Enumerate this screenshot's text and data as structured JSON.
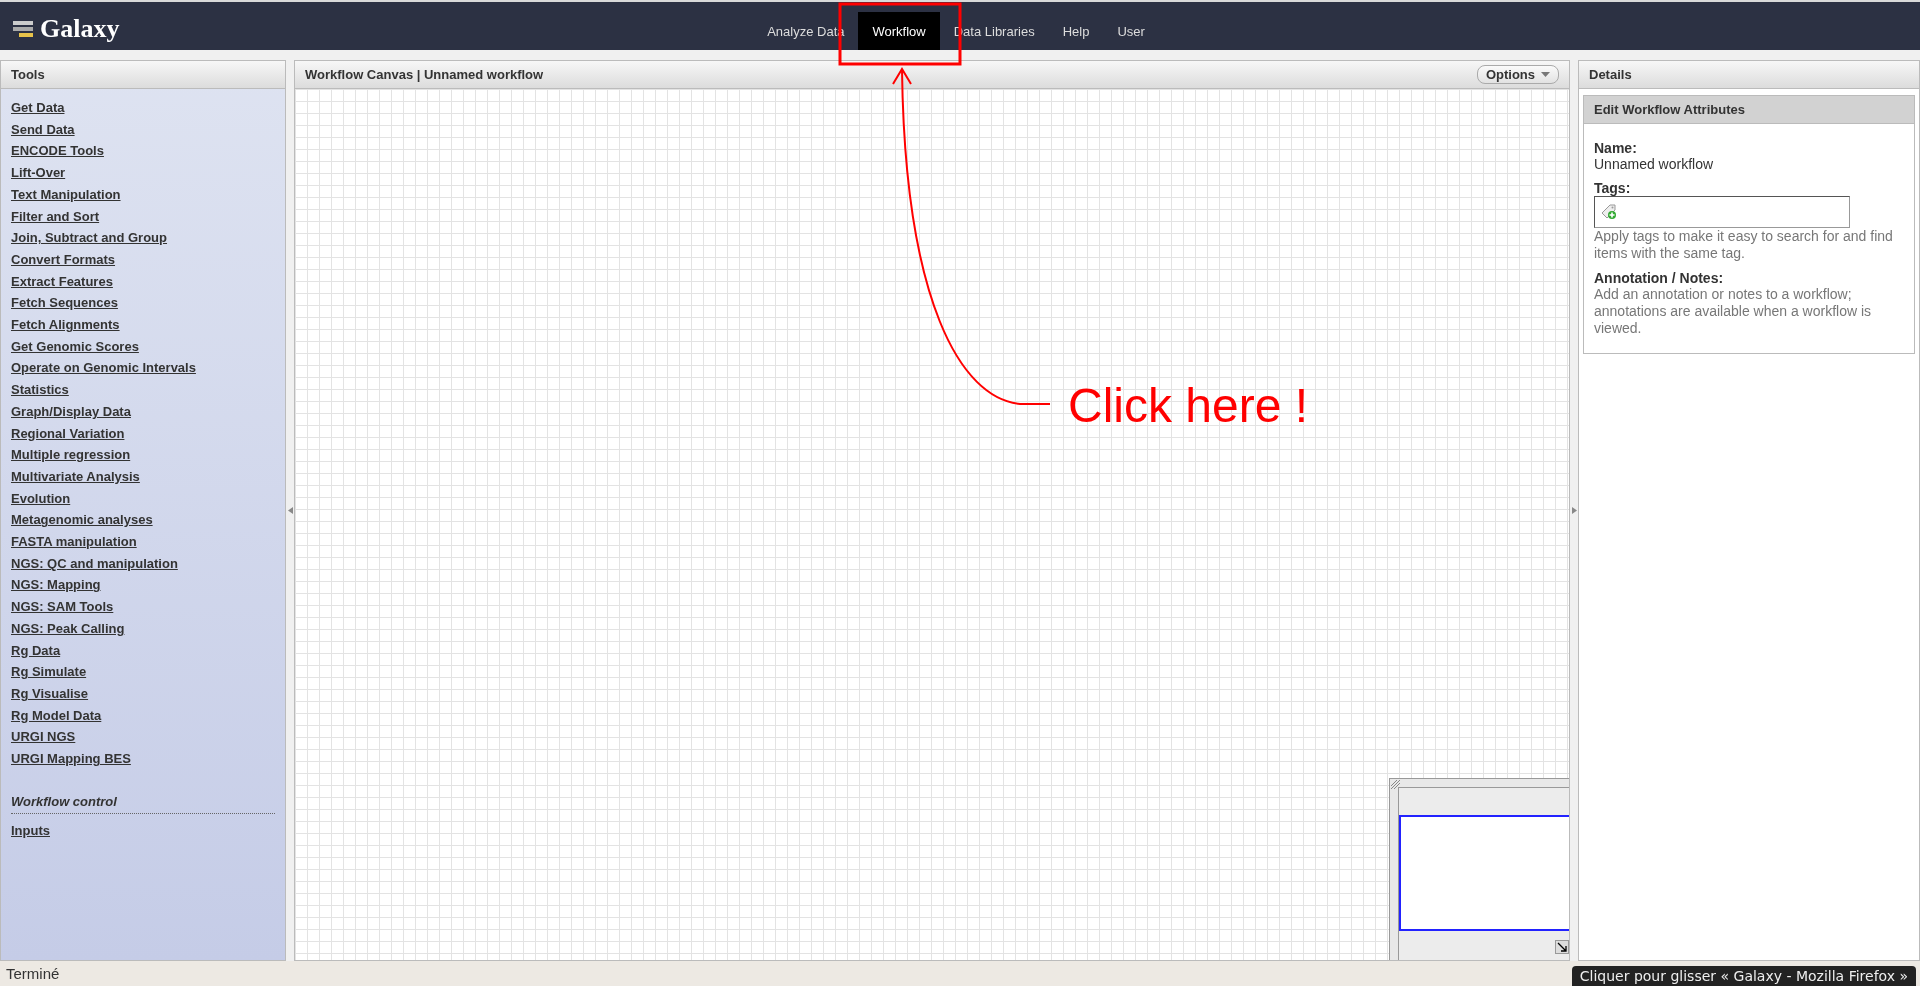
{
  "masthead": {
    "brand": "Galaxy",
    "nav": [
      {
        "label": "Analyze Data",
        "selected": false
      },
      {
        "label": "Workflow",
        "selected": true
      },
      {
        "label": "Data Libraries",
        "selected": false
      },
      {
        "label": "Help",
        "selected": false
      },
      {
        "label": "User",
        "selected": false
      }
    ]
  },
  "tool_panel": {
    "title": "Tools",
    "sections": [
      "Get Data",
      "Send Data",
      "ENCODE Tools",
      "Lift-Over",
      "Text Manipulation",
      "Filter and Sort",
      "Join, Subtract and Group",
      "Convert Formats",
      "Extract Features",
      "Fetch Sequences",
      "Fetch Alignments",
      "Get Genomic Scores",
      "Operate on Genomic Intervals",
      "Statistics",
      "Graph/Display Data",
      "Regional Variation",
      "Multiple regression",
      "Multivariate Analysis",
      "Evolution",
      "Metagenomic analyses",
      "FASTA manipulation",
      "NGS: QC and manipulation",
      "NGS: Mapping",
      "NGS: SAM Tools",
      "NGS: Peak Calling",
      "Rg Data",
      "Rg Simulate",
      "Rg Visualise",
      "Rg Model Data",
      "URGI NGS",
      "URGI Mapping BES"
    ],
    "workflow_control": {
      "title": "Workflow control",
      "items": [
        "Inputs"
      ]
    }
  },
  "canvas_panel": {
    "title": "Workflow Canvas | Unnamed workflow",
    "options_button": "Options"
  },
  "details_panel": {
    "title": "Details",
    "form": {
      "title": "Edit Workflow Attributes",
      "name_label": "Name:",
      "name_value": "Unnamed workflow",
      "tags_label": "Tags:",
      "tags_help": "Apply tags to make it easy to search for and find items with the same tag.",
      "annotation_label": "Annotation / Notes:",
      "annotation_help": "Add an annotation or notes to a workflow; annotations are available when a workflow is viewed."
    }
  },
  "annotation": {
    "text": "Click here !"
  },
  "status_bar": {
    "text": "Terminé"
  },
  "tooltip": {
    "text": "Cliquer pour glisser « Galaxy - Mozilla Firefox »"
  }
}
